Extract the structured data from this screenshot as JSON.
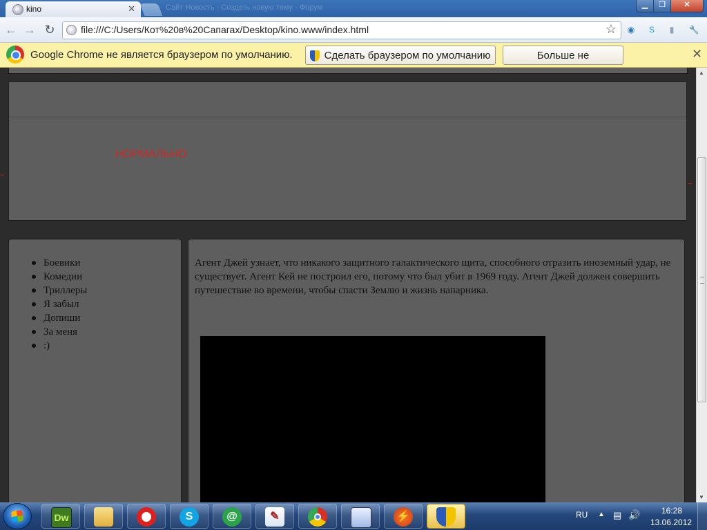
{
  "browser": {
    "tab_title": "kino",
    "faded_tabs_text": "Сайт Новость · Создать новую тему · Форум",
    "url": "file:///C:/Users/Кот%20в%20Сапагах/Desktop/kino.www/index.html"
  },
  "infobar": {
    "message": "Google Chrome не является браузером по умолчанию.",
    "set_default_label": "Сделать браузером по умолчанию",
    "never_ask_label": "Больше не спрашивать"
  },
  "page": {
    "header_text": "НОРМАЛЬНО",
    "menu_items": [
      "Боевики",
      "Комедии",
      "Триллеры",
      "Я забыл",
      "Допиши",
      "За меня",
      ":)"
    ],
    "description": "Агент Джей узнает, что никакого защитного галактического щита, способного отразить иноземный удар, не существует. Агент Кей не построил его, потому что был убит в 1969 году. Агент Джей должен совершить путешествие во времени, чтобы спасти Землю и жизнь напарника."
  },
  "taskbar": {
    "apps": [
      {
        "name": "dreamweaver",
        "label": "Dw"
      },
      {
        "name": "file-explorer",
        "label": ""
      },
      {
        "name": "opera",
        "label": ""
      },
      {
        "name": "skype",
        "label": "S"
      },
      {
        "name": "mail-agent",
        "label": "@"
      },
      {
        "name": "notepad",
        "label": "✎"
      },
      {
        "name": "chrome",
        "label": ""
      },
      {
        "name": "monitor",
        "label": ""
      },
      {
        "name": "flash",
        "label": "⚡"
      },
      {
        "name": "security-shield",
        "label": ""
      }
    ],
    "language": "RU",
    "time": "16:28",
    "date": "13.06.2012"
  },
  "colors": {
    "header_text": "#cc2a26",
    "panel": "#5e5e5e",
    "page_bg": "#2c2c2c"
  }
}
